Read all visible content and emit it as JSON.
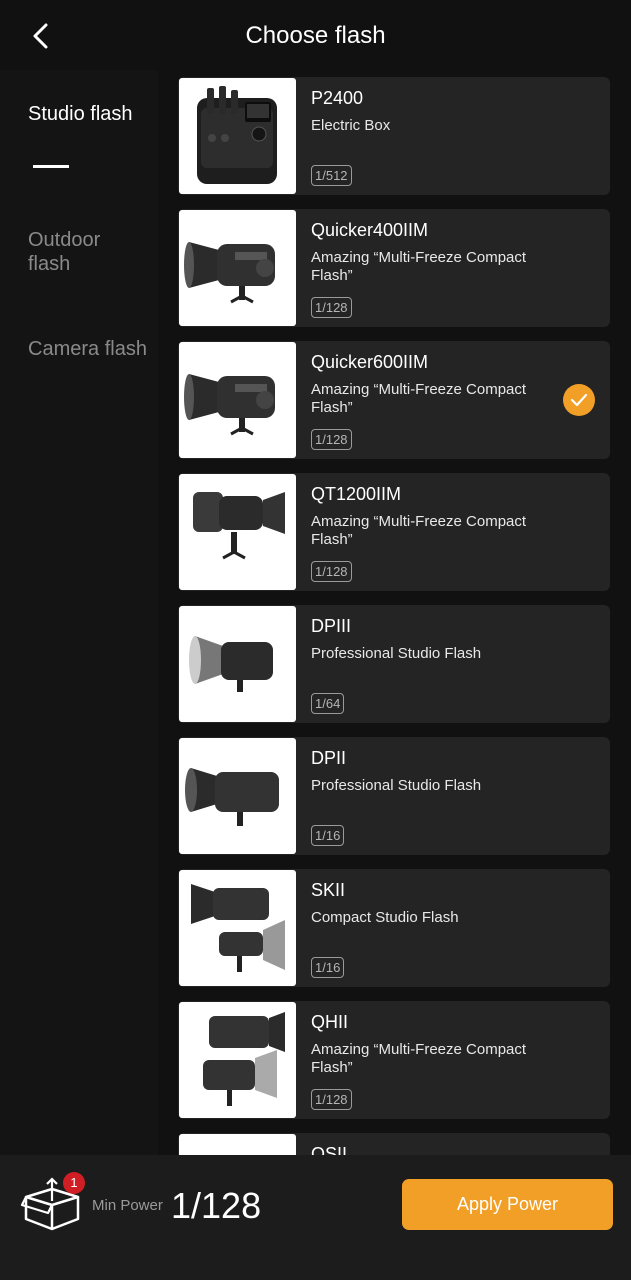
{
  "header": {
    "title": "Choose flash",
    "back_icon": "chevron-left-icon"
  },
  "sidebar": {
    "items": [
      {
        "label": "Studio flash",
        "active": true
      },
      {
        "label": "Outdoor flash",
        "active": false
      },
      {
        "label": "Camera flash",
        "active": false
      }
    ]
  },
  "products": [
    {
      "name": "P2400",
      "desc": "Electric Box",
      "power": "1/512",
      "selected": false
    },
    {
      "name": "Quicker400IIM",
      "desc": "Amazing “Multi-Freeze Compact Flash”",
      "power": "1/128",
      "selected": false
    },
    {
      "name": "Quicker600IIM",
      "desc": "Amazing “Multi-Freeze Compact Flash”",
      "power": "1/128",
      "selected": true
    },
    {
      "name": "QT1200IIM",
      "desc": "Amazing “Multi-Freeze Compact Flash”",
      "power": "1/128",
      "selected": false
    },
    {
      "name": "DPIII",
      "desc": "Professional Studio Flash",
      "power": "1/64",
      "selected": false
    },
    {
      "name": "DPII",
      "desc": "Professional Studio Flash",
      "power": "1/16",
      "selected": false
    },
    {
      "name": "SKII",
      "desc": "Compact Studio Flash",
      "power": "1/16",
      "selected": false
    },
    {
      "name": "QHII",
      "desc": "Amazing “Multi-Freeze Compact Flash”",
      "power": "1/128",
      "selected": false
    },
    {
      "name": "QSII",
      "desc": "",
      "power": "",
      "selected": false
    }
  ],
  "footer": {
    "badge_count": "1",
    "min_power_label": "Min Power",
    "min_power_value": "1/128",
    "apply_label": "Apply Power",
    "box_icon": "open-box-icon"
  },
  "colors": {
    "accent": "#f29f27",
    "badge": "#d01f24",
    "card": "#242424",
    "background": "#111111"
  }
}
